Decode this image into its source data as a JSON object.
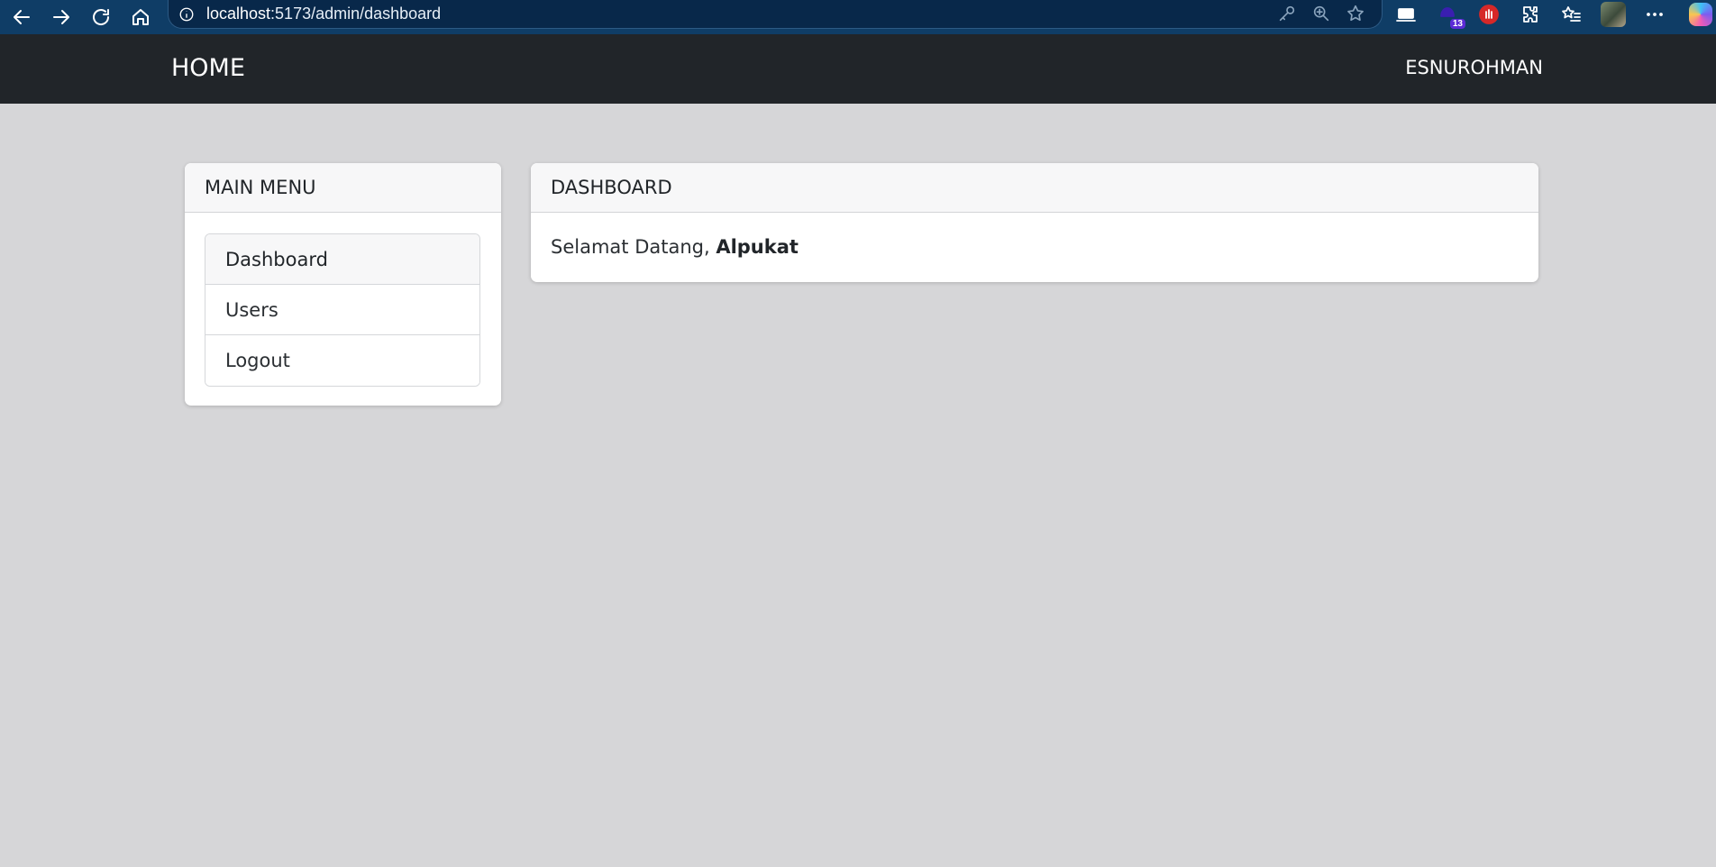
{
  "browser": {
    "url_host": "localhost",
    "url_rest": ":5173/admin/dashboard",
    "extension_badge": "13"
  },
  "navbar": {
    "brand": "HOME",
    "user": "ESNUROHMAN"
  },
  "menu": {
    "title": "MAIN MENU",
    "items": [
      {
        "label": "Dashboard",
        "active": true
      },
      {
        "label": "Users",
        "active": false
      },
      {
        "label": "Logout",
        "active": false
      }
    ]
  },
  "dashboard": {
    "title": "DASHBOARD",
    "greeting": "Selamat Datang, ",
    "name": "Alpukat"
  }
}
